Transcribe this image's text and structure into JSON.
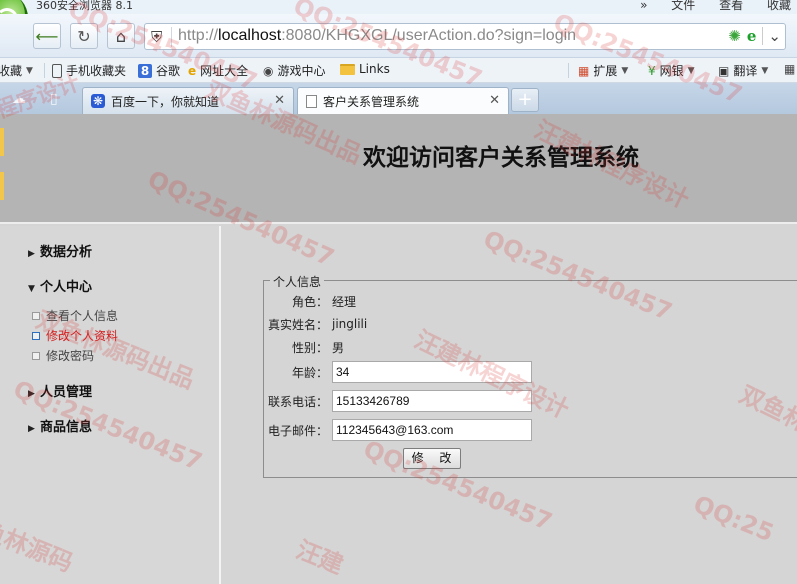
{
  "window": {
    "app_title": "360安全浏览器 8.1",
    "menu": [
      "文件",
      "查看",
      "收藏"
    ]
  },
  "nav": {
    "url_prefix": "http://",
    "url_host": "localhost",
    "url_rest": ":8080/KHGXGL/userAction.do?sign=login"
  },
  "bookmarks": [
    {
      "label": "收藏",
      "icon": "star-icon"
    },
    {
      "label": "手机收藏夹",
      "icon": "phone-icon"
    },
    {
      "label": "谷歌",
      "icon": "google-icon"
    },
    {
      "label": "网址大全",
      "icon": "ie-icon"
    },
    {
      "label": "游戏中心",
      "icon": "gamepad-icon"
    },
    {
      "label": "Links",
      "icon": "folder-icon"
    }
  ],
  "bookmarks_right": [
    {
      "label": "扩展",
      "icon": "grid-icon"
    },
    {
      "label": "网银",
      "icon": "bank-icon"
    },
    {
      "label": "翻译",
      "icon": "translate-icon"
    }
  ],
  "tabs": [
    {
      "label": "百度一下，你就知道",
      "active": false
    },
    {
      "label": "客户关系管理系统",
      "active": true
    }
  ],
  "page": {
    "title": "欢迎访问客户关系管理系统",
    "sidebar": {
      "sections": [
        {
          "label": "数据分析",
          "expanded": false
        },
        {
          "label": "个人中心",
          "expanded": true,
          "items": [
            {
              "label": "查看个人信息",
              "active": false
            },
            {
              "label": "修改个人资料",
              "active": true
            },
            {
              "label": "修改密码",
              "active": false
            }
          ]
        },
        {
          "label": "人员管理",
          "expanded": false
        },
        {
          "label": "商品信息",
          "expanded": false
        }
      ]
    },
    "form": {
      "legend": "个人信息",
      "role_label": "角色：",
      "role": "经理",
      "realname_label": "真实姓名：",
      "realname": "jinglili",
      "gender_label": "性别：",
      "gender": "男",
      "age_label": "年龄：",
      "age": "34",
      "phone_label": "联系电话：",
      "phone": "15133426789",
      "email_label": "电子邮件：",
      "email": "112345643@163.com",
      "submit_label": "修 改"
    }
  },
  "watermarks": {
    "qq": "QQ:254540457",
    "qq_short": "QQ:25",
    "cn1": "汪建林程序设计",
    "cn2": "双鱼林源码出品",
    "cn3": "双鱼林",
    "cn4": "汪建",
    "cn5": "程序设计",
    "cn6": "鱼林源码"
  },
  "colors": {
    "header_bg": "#b4b4b4",
    "page_bg": "#d5d5d5",
    "active_link": "#d21f1f",
    "watermark": "#dc3c3c"
  }
}
